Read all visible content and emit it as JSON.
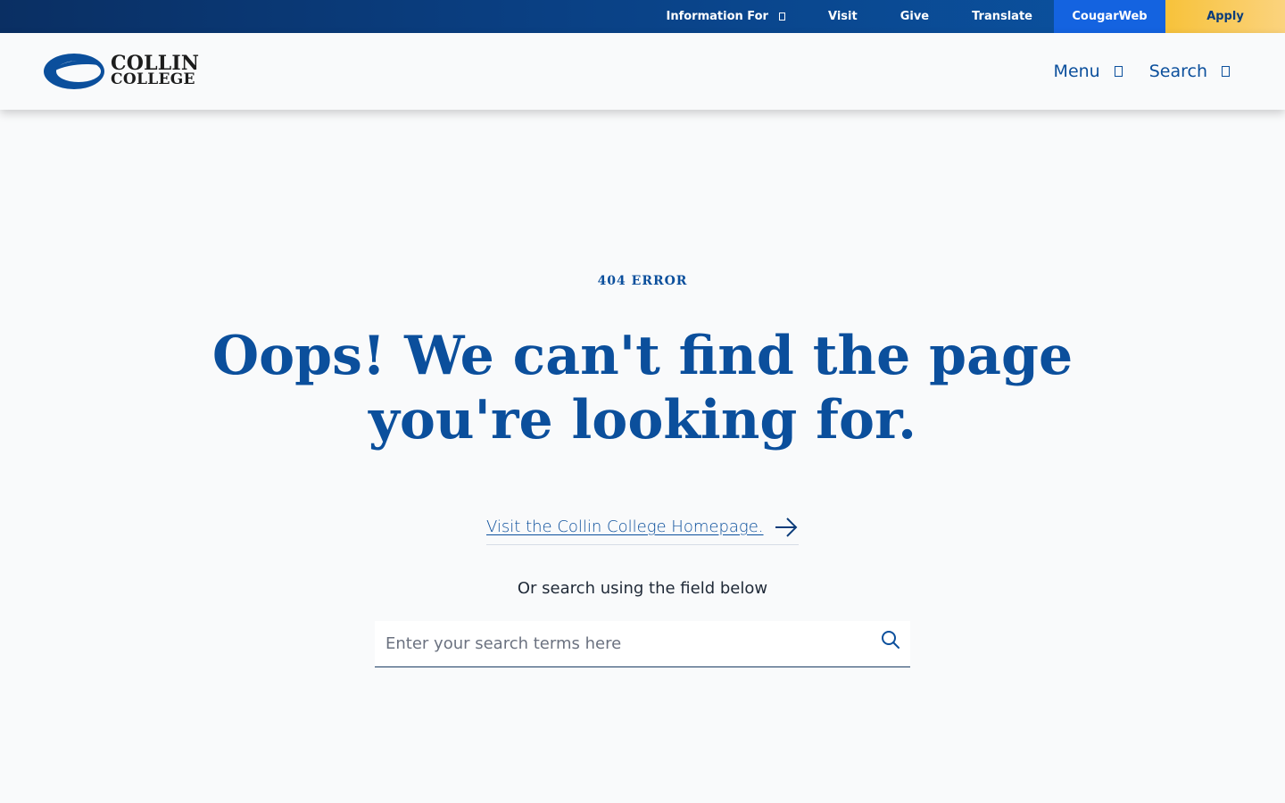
{
  "utility_nav": {
    "information_for": "Information For",
    "visit": "Visit",
    "give": "Give",
    "translate": "Translate",
    "cougarweb": "CougarWeb",
    "apply": "Apply"
  },
  "header": {
    "logo_line1": "COLLIN",
    "logo_line2": "COLLEGE",
    "menu_label": "Menu",
    "search_label": "Search"
  },
  "main": {
    "eyebrow": "404 ERROR",
    "headline": "Oops! We can't find the page you're looking for.",
    "home_link": "Visit the Collin College Homepage.",
    "or_search": "Or search using the field below",
    "search_placeholder": "Enter your search terms here"
  },
  "colors": {
    "brand_blue": "#0b4f9c",
    "utility_bar": "#0a3f82",
    "cougarweb_bg": "#1463e0",
    "apply_bg": "#f7c23a",
    "page_bg": "#f9fafb"
  },
  "icons": [
    "chevron-down-icon",
    "arrow-right-icon",
    "search-icon",
    "collin-college-logo-swoosh"
  ]
}
